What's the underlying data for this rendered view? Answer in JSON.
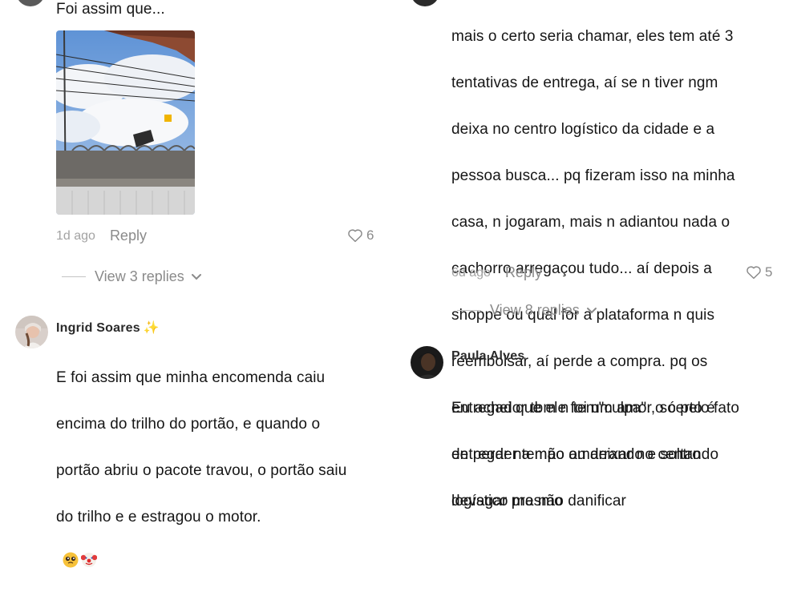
{
  "left": {
    "first_comment": {
      "text": "Foi assim que...",
      "time": "1d ago",
      "reply": "Reply",
      "likes": "6",
      "view_replies": "View 3 replies"
    },
    "second_comment": {
      "username": "Ingrid Soares",
      "username_emoji": "✨",
      "lines": [
        "E foi assim que minha encomenda caiu",
        "encima do trilho do portão, e quando o",
        "portão abriu o pacote travou, o portão saiu",
        "do trilho e e estragou o motor."
      ],
      "trailing_emojis": [
        "pleading-face",
        "clown-face"
      ]
    }
  },
  "right": {
    "first_comment": {
      "lines": [
        "mais o certo seria chamar, eles tem até 3",
        "tentativas de entrega, aí se n tiver ngm",
        "deixa no centro logístico da cidade e a",
        "pessoa busca... pq fizeram isso na minha",
        "casa, n jogaram, mais n adiantou nada o",
        "cachorro arregaçou tudo... aí depois a",
        "shoppe ou qual for a plataforma n quis",
        "reembolsar, aí perde a compra. pq os",
        "entregador tbm n tem\"culpa\". o certo é",
        "entregar na mão ou deixar no centro",
        "logístico mesmo"
      ],
      "time": "6d ago",
      "reply": "Reply",
      "likes": "5",
      "view_replies": "View 8 replies"
    },
    "second_comment": {
      "username": "Paula Alves",
      "lines": [
        "Eu achei que ele foi um amor, só pelo fato",
        "de perder tempo amarrando e soltando",
        "devagar pra não danificar"
      ]
    }
  },
  "colors": {
    "text": "#161616",
    "meta": "#8a8a8a",
    "time": "#a3a3a3",
    "sparkle": "#f0c419"
  }
}
